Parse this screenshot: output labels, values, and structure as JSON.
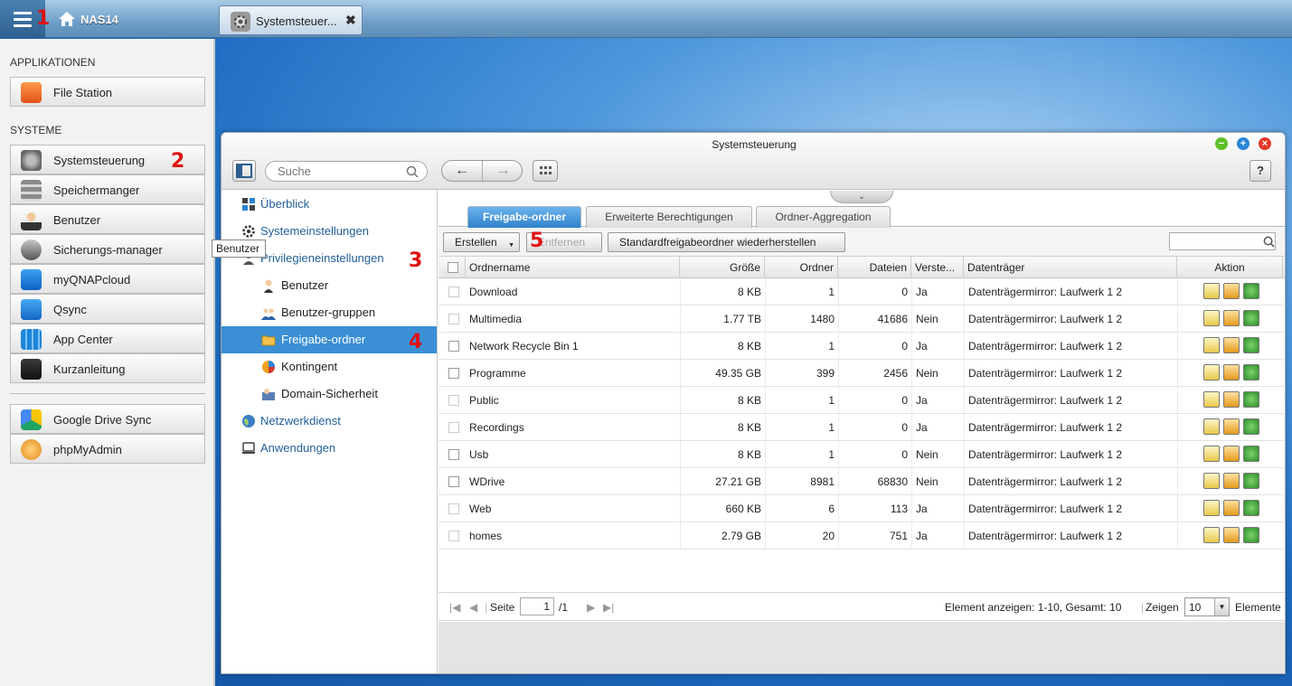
{
  "topbar": {
    "nas_name": "NAS14",
    "annotation": "1"
  },
  "app_tab": {
    "label": "Systemsteuer...",
    "close": "✖"
  },
  "sidebar": {
    "section_apps": "APPLIKATIONEN",
    "apps": [
      {
        "label": "File Station",
        "icon": "folder-icon"
      }
    ],
    "section_system": "SYSTEME",
    "system": [
      {
        "label": "Systemsteuerung",
        "icon": "gear-icon"
      },
      {
        "label": "Speichermanger",
        "icon": "storage-icon"
      },
      {
        "label": "Benutzer",
        "icon": "user-icon"
      },
      {
        "label": "Sicherungs-manager",
        "icon": "backup-icon"
      },
      {
        "label": "myQNAPcloud",
        "icon": "cloud-icon"
      },
      {
        "label": "Qsync",
        "icon": "sync-icon"
      },
      {
        "label": "App Center",
        "icon": "grid-icon"
      },
      {
        "label": "Kurzanleitung",
        "icon": "presentation-icon"
      }
    ],
    "extras": [
      {
        "label": "Google Drive Sync",
        "icon": "google-drive-icon"
      },
      {
        "label": "phpMyAdmin",
        "icon": "phpmyadmin-icon"
      }
    ],
    "annotation": "2",
    "tooltip": "Benutzer"
  },
  "window": {
    "title": "Systemsteuerung",
    "search_placeholder": "Suche",
    "back": "←",
    "forward": "→",
    "help": "?"
  },
  "nav": [
    {
      "label": "Überblick",
      "level": 0
    },
    {
      "label": "Systemeinstellungen",
      "level": 0
    },
    {
      "label": "Privilegieneinstellungen",
      "level": 0
    },
    {
      "label": "Benutzer",
      "level": 1
    },
    {
      "label": "Benutzer-gruppen",
      "level": 1
    },
    {
      "label": "Freigabe-ordner",
      "level": 1,
      "active": true
    },
    {
      "label": "Kontingent",
      "level": 1
    },
    {
      "label": "Domain-Sicherheit",
      "level": 1
    },
    {
      "label": "Netzwerkdienst",
      "level": 0
    },
    {
      "label": "Anwendungen",
      "level": 0
    }
  ],
  "nav_annotations": {
    "privileges": "3",
    "shared": "4"
  },
  "tabs": [
    "Freigabe-ordner",
    "Erweiterte Berechtigungen",
    "Ordner-Aggregation"
  ],
  "toolbar": {
    "create": "Erstellen",
    "remove": "Entfernen",
    "restore": "Standardfreigabeordner wiederherstellen",
    "annotation": "5"
  },
  "columns": [
    "Ordnername",
    "Größe",
    "Ordner",
    "Dateien",
    "Verste...",
    "Datenträger",
    "Aktion"
  ],
  "rows": [
    {
      "name": "Download",
      "size": "8 KB",
      "folders": "1",
      "files": "0",
      "hidden": "Ja",
      "volume": "Datenträgermirror: Laufwerk 1 2",
      "cb_dim": true
    },
    {
      "name": "Multimedia",
      "size": "1.77 TB",
      "folders": "1480",
      "files": "41686",
      "hidden": "Nein",
      "volume": "Datenträgermirror: Laufwerk 1 2",
      "cb_dim": true
    },
    {
      "name": "Network Recycle Bin 1",
      "size": "8 KB",
      "folders": "1",
      "files": "0",
      "hidden": "Ja",
      "volume": "Datenträgermirror: Laufwerk 1 2",
      "cb_dim": false
    },
    {
      "name": "Programme",
      "size": "49.35 GB",
      "folders": "399",
      "files": "2456",
      "hidden": "Nein",
      "volume": "Datenträgermirror: Laufwerk 1 2",
      "cb_dim": false
    },
    {
      "name": "Public",
      "size": "8 KB",
      "folders": "1",
      "files": "0",
      "hidden": "Ja",
      "volume": "Datenträgermirror: Laufwerk 1 2",
      "cb_dim": true
    },
    {
      "name": "Recordings",
      "size": "8 KB",
      "folders": "1",
      "files": "0",
      "hidden": "Ja",
      "volume": "Datenträgermirror: Laufwerk 1 2",
      "cb_dim": true
    },
    {
      "name": "Usb",
      "size": "8 KB",
      "folders": "1",
      "files": "0",
      "hidden": "Nein",
      "volume": "Datenträgermirror: Laufwerk 1 2",
      "cb_dim": false
    },
    {
      "name": "WDrive",
      "size": "27.21 GB",
      "folders": "8981",
      "files": "68830",
      "hidden": "Nein",
      "volume": "Datenträgermirror: Laufwerk 1 2",
      "cb_dim": false
    },
    {
      "name": "Web",
      "size": "660 KB",
      "folders": "6",
      "files": "113",
      "hidden": "Ja",
      "volume": "Datenträgermirror: Laufwerk 1 2",
      "cb_dim": true
    },
    {
      "name": "homes",
      "size": "2.79 GB",
      "folders": "20",
      "files": "751",
      "hidden": "Ja",
      "volume": "Datenträgermirror: Laufwerk 1 2",
      "cb_dim": true
    }
  ],
  "pager": {
    "page_label": "Seite",
    "page": "1",
    "of": "/1",
    "summary": "Element anzeigen: 1-10, Gesamt: 10",
    "show_label": "Zeigen",
    "per_page": "10",
    "items_label": "Elemente"
  },
  "colors": {
    "accent": "#3b8fd4",
    "annotation": "#e01010",
    "nav_text": "#1f5e9a"
  }
}
